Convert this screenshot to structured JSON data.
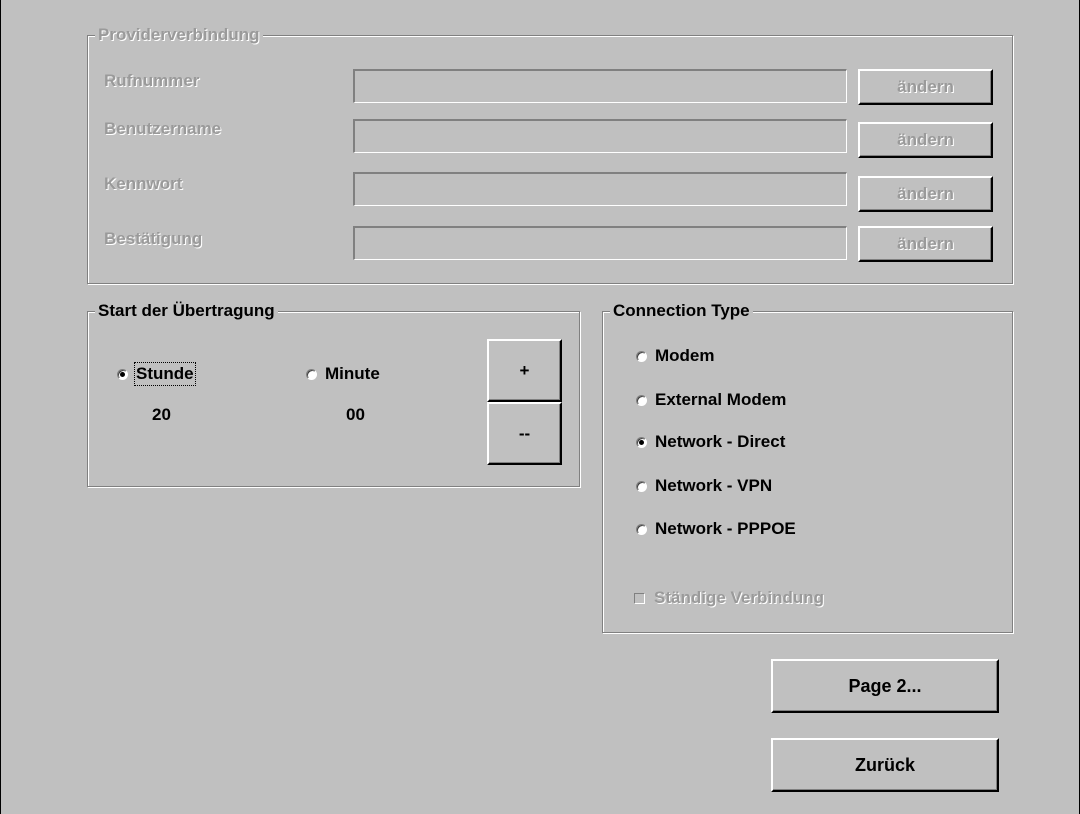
{
  "provider": {
    "title": "Providerverbindung",
    "rows": [
      {
        "label": "Rufnummer",
        "value": "",
        "button": "ändern"
      },
      {
        "label": "Benutzername",
        "value": "",
        "button": "ändern"
      },
      {
        "label": "Kennwort",
        "value": "",
        "button": "ändern"
      },
      {
        "label": "Bestätigung",
        "value": "",
        "button": "ändern"
      }
    ]
  },
  "start": {
    "title": "Start der Übertragung",
    "hour_label": "Stunde",
    "minute_label": "Minute",
    "hour_value": "20",
    "minute_value": "00",
    "selected": "Stunde",
    "plus_label": "+",
    "minus_label": "--"
  },
  "connection": {
    "title": "Connection Type",
    "options": [
      "Modem",
      "External Modem",
      "Network - Direct",
      "Network - VPN",
      "Network - PPPOE"
    ],
    "selected": "Network - Direct",
    "permanent_label": "Ständige Verbindung",
    "permanent_checked": false
  },
  "buttons": {
    "page2": "Page 2...",
    "back": "Zurück"
  }
}
